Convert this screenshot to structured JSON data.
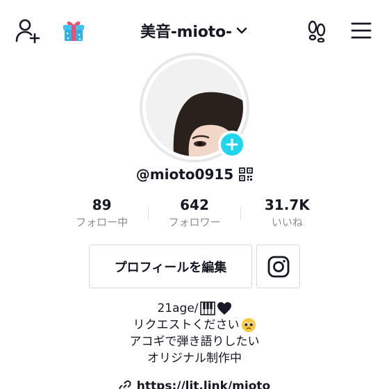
{
  "header": {
    "account_name": "美音-mioto-",
    "icons": {
      "add_user": "add-user-icon",
      "gift": "gift-icon",
      "dropdown": "chevron-down-icon",
      "footprint": "footprint-icon",
      "menu": "hamburger-menu-icon"
    }
  },
  "profile": {
    "handle": "@mioto0915",
    "accent_color": "#20d5ec"
  },
  "stats": [
    {
      "value": "89",
      "label": "フォロー中"
    },
    {
      "value": "642",
      "label": "フォロワー"
    },
    {
      "value": "31.7K",
      "label": "いいね"
    }
  ],
  "actions": {
    "edit_profile_label": "プロフィールを編集"
  },
  "bio": {
    "line1": "21age/",
    "line2": "リクエストください",
    "line3": "アコギで弾き語りしたい",
    "line4": "オリジナル制作中"
  },
  "link": {
    "text": "https://lit.link/mioto"
  }
}
